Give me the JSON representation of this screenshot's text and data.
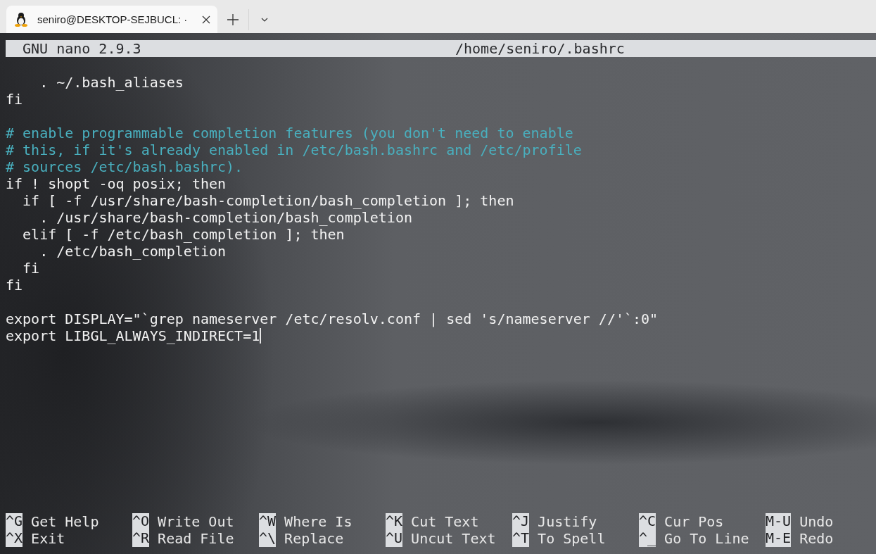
{
  "tabs": [
    {
      "title": "seniro@DESKTOP-SEJBUCL: ·",
      "selected": true
    }
  ],
  "header": {
    "version": "GNU nano 2.9.3",
    "file": "/home/seniro/.bashrc"
  },
  "lines": [
    {
      "kind": "blank",
      "cursor": false
    },
    {
      "kind": "code",
      "text": "    . ~/.bash_aliases",
      "cursor": false
    },
    {
      "kind": "code",
      "text": "fi",
      "cursor": false
    },
    {
      "kind": "blank",
      "cursor": false
    },
    {
      "kind": "comment",
      "text": "# enable programmable completion features (you don't need to enable",
      "cursor": false
    },
    {
      "kind": "comment",
      "text": "# this, if it's already enabled in /etc/bash.bashrc and /etc/profile",
      "cursor": false
    },
    {
      "kind": "comment",
      "text": "# sources /etc/bash.bashrc).",
      "cursor": false
    },
    {
      "kind": "code",
      "text": "if ! shopt -oq posix; then",
      "cursor": false
    },
    {
      "kind": "code",
      "text": "  if [ -f /usr/share/bash-completion/bash_completion ]; then",
      "cursor": false
    },
    {
      "kind": "code",
      "text": "    . /usr/share/bash-completion/bash_completion",
      "cursor": false
    },
    {
      "kind": "code",
      "text": "  elif [ -f /etc/bash_completion ]; then",
      "cursor": false
    },
    {
      "kind": "code",
      "text": "    . /etc/bash_completion",
      "cursor": false
    },
    {
      "kind": "code",
      "text": "  fi",
      "cursor": false
    },
    {
      "kind": "code",
      "text": "fi",
      "cursor": false
    },
    {
      "kind": "blank",
      "cursor": false
    },
    {
      "kind": "code",
      "text": "export DISPLAY=\"`grep nameserver /etc/resolv.conf | sed 's/nameserver //'`:0\"",
      "cursor": false
    },
    {
      "kind": "code",
      "text": "export LIBGL_ALWAYS_INDIRECT=1",
      "cursor": true
    }
  ],
  "shortcuts": [
    {
      "key": "^G",
      "label": "Get Help"
    },
    {
      "key": "^O",
      "label": "Write Out"
    },
    {
      "key": "^W",
      "label": "Where Is"
    },
    {
      "key": "^K",
      "label": "Cut Text"
    },
    {
      "key": "^J",
      "label": "Justify"
    },
    {
      "key": "^C",
      "label": "Cur Pos"
    },
    {
      "key": "M-U",
      "label": "Undo"
    },
    {
      "key": "^X",
      "label": "Exit"
    },
    {
      "key": "^R",
      "label": "Read File"
    },
    {
      "key": "^\\",
      "label": "Replace"
    },
    {
      "key": "^U",
      "label": "Uncut Text"
    },
    {
      "key": "^T",
      "label": "To Spell"
    },
    {
      "key": "^_",
      "label": "Go To Line"
    },
    {
      "key": "M-E",
      "label": "Redo"
    }
  ]
}
